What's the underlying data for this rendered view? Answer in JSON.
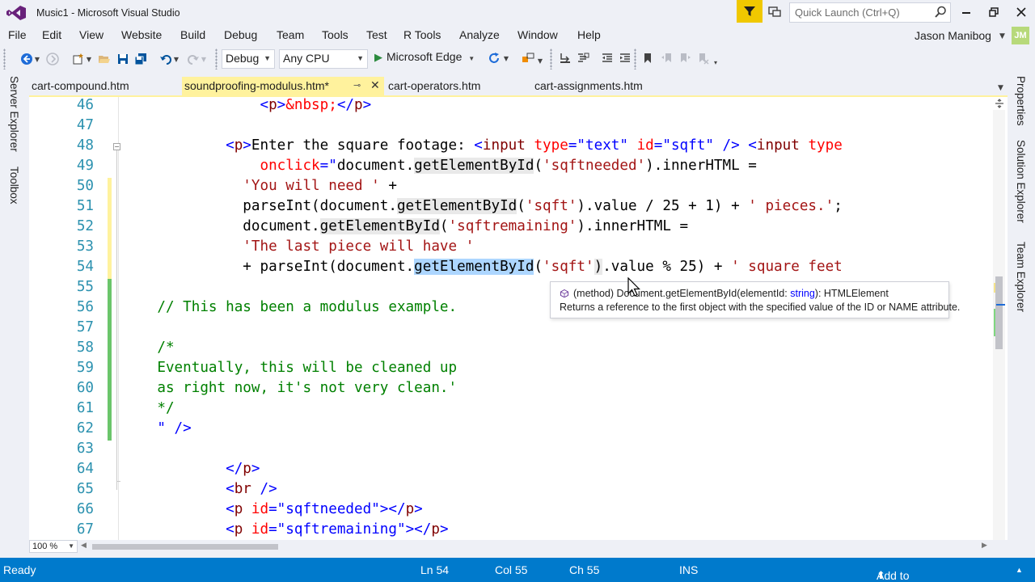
{
  "window": {
    "title": "Music1 - Microsoft Visual Studio",
    "quick_launch_placeholder": "Quick Launch (Ctrl+Q)",
    "user_name": "Jason Manibog",
    "user_initials": "JM"
  },
  "menu": [
    "File",
    "Edit",
    "View",
    "Website",
    "Build",
    "Debug",
    "Team",
    "Tools",
    "Test",
    "R Tools",
    "Analyze",
    "Window",
    "Help"
  ],
  "toolbar": {
    "configuration": "Debug",
    "platform": "Any CPU",
    "start_target": "Microsoft Edge"
  },
  "side_panels": {
    "left": [
      "Server Explorer",
      "Toolbox"
    ],
    "right": [
      "Properties",
      "Solution Explorer",
      "Team Explorer"
    ]
  },
  "tabs": [
    {
      "label": "cart-compound.htm",
      "active": false
    },
    {
      "label": "soundproofing-modulus.htm*",
      "active": true
    },
    {
      "label": "cart-operators.htm",
      "active": false
    },
    {
      "label": "cart-assignments.htm",
      "active": false
    }
  ],
  "editor": {
    "lines": [
      {
        "n": "46",
        "segments": [
          [
            "                <",
            "t-br"
          ],
          [
            "p",
            "t-tag"
          ],
          [
            ">",
            "t-br"
          ],
          [
            "&nbsp;",
            "t-attr"
          ],
          [
            "</",
            "t-br"
          ],
          [
            "p",
            "t-tag"
          ],
          [
            ">",
            "t-br"
          ]
        ]
      },
      {
        "n": "47",
        "segments": []
      },
      {
        "n": "48",
        "segments": [
          [
            "            <",
            "t-br"
          ],
          [
            "p",
            "t-tag"
          ],
          [
            ">",
            "t-br"
          ],
          [
            "Enter the square footage: ",
            ""
          ],
          [
            "<",
            "t-br"
          ],
          [
            "input",
            "t-tag"
          ],
          [
            " ",
            ""
          ],
          [
            "type",
            "t-attr"
          ],
          [
            "=",
            "t-br"
          ],
          [
            "\"text\"",
            "t-val"
          ],
          [
            " ",
            ""
          ],
          [
            "id",
            "t-attr"
          ],
          [
            "=",
            "t-br"
          ],
          [
            "\"sqft\"",
            "t-val"
          ],
          [
            " />",
            "t-br"
          ],
          [
            " <",
            "t-br"
          ],
          [
            "input",
            "t-tag"
          ],
          [
            " ",
            ""
          ],
          [
            "type",
            "t-attr"
          ]
        ]
      },
      {
        "n": "49",
        "segments": [
          [
            "                ",
            ""
          ],
          [
            "onclick",
            "t-attr"
          ],
          [
            "=",
            "t-br"
          ],
          [
            "\"",
            "t-val"
          ],
          [
            "document.",
            ""
          ],
          [
            "getElementById",
            "t-hl"
          ],
          [
            "(",
            ""
          ],
          [
            "'sqftneeded'",
            "t-str"
          ],
          [
            ").innerHTML =",
            ""
          ]
        ]
      },
      {
        "n": "50",
        "segments": [
          [
            "              ",
            ""
          ],
          [
            "'You will need '",
            "t-str"
          ],
          [
            " +",
            ""
          ]
        ]
      },
      {
        "n": "51",
        "segments": [
          [
            "              parseInt(document.",
            ""
          ],
          [
            "getElementById",
            "t-hl"
          ],
          [
            "(",
            ""
          ],
          [
            "'sqft'",
            "t-str"
          ],
          [
            ").value / 25 + 1) + ",
            ""
          ],
          [
            "' pieces.'",
            "t-str"
          ],
          [
            ";",
            ""
          ]
        ]
      },
      {
        "n": "52",
        "segments": [
          [
            "              document.",
            ""
          ],
          [
            "getElementById",
            "t-hl"
          ],
          [
            "(",
            ""
          ],
          [
            "'sqftremaining'",
            "t-str"
          ],
          [
            ").innerHTML =",
            ""
          ]
        ]
      },
      {
        "n": "53",
        "segments": [
          [
            "              ",
            ""
          ],
          [
            "'The last piece will have '",
            "t-str"
          ]
        ]
      },
      {
        "n": "54",
        "segments": [
          [
            "              + parseInt(document.",
            ""
          ],
          [
            "getElementById",
            "t-sel"
          ],
          [
            "(",
            ""
          ],
          [
            "'sqft'",
            "t-str"
          ],
          [
            ")",
            "t-hl"
          ],
          [
            ".value % 25) + ",
            ""
          ],
          [
            "' square feet",
            "t-str"
          ]
        ]
      },
      {
        "n": "55",
        "segments": []
      },
      {
        "n": "56",
        "segments": [
          [
            "    ",
            ""
          ],
          [
            "// This has been a modulus example.",
            "t-cmt"
          ]
        ]
      },
      {
        "n": "57",
        "segments": []
      },
      {
        "n": "58",
        "segments": [
          [
            "    ",
            ""
          ],
          [
            "/*",
            "t-cmt"
          ]
        ]
      },
      {
        "n": "59",
        "segments": [
          [
            "    ",
            ""
          ],
          [
            "Eventually, this will be cleaned up",
            "t-cmt"
          ]
        ]
      },
      {
        "n": "60",
        "segments": [
          [
            "    ",
            ""
          ],
          [
            "as right now, it's not very clean.'",
            "t-cmt"
          ]
        ]
      },
      {
        "n": "61",
        "segments": [
          [
            "    ",
            ""
          ],
          [
            "*/",
            "t-cmt"
          ]
        ]
      },
      {
        "n": "62",
        "segments": [
          [
            "    ",
            ""
          ],
          [
            "\" />",
            "t-val"
          ]
        ]
      },
      {
        "n": "63",
        "segments": []
      },
      {
        "n": "64",
        "segments": [
          [
            "            </",
            "t-br"
          ],
          [
            "p",
            "t-tag"
          ],
          [
            ">",
            "t-br"
          ]
        ]
      },
      {
        "n": "65",
        "segments": [
          [
            "            <",
            "t-br"
          ],
          [
            "br",
            "t-tag"
          ],
          [
            " />",
            "t-br"
          ]
        ]
      },
      {
        "n": "66",
        "segments": [
          [
            "            <",
            "t-br"
          ],
          [
            "p",
            "t-tag"
          ],
          [
            " ",
            ""
          ],
          [
            "id",
            "t-attr"
          ],
          [
            "=",
            "t-br"
          ],
          [
            "\"sqftneeded\"",
            "t-val"
          ],
          [
            "></",
            "t-br"
          ],
          [
            "p",
            "t-tag"
          ],
          [
            ">",
            "t-br"
          ]
        ]
      },
      {
        "n": "67",
        "segments": [
          [
            "            <",
            "t-br"
          ],
          [
            "p",
            "t-tag"
          ],
          [
            " ",
            ""
          ],
          [
            "id",
            "t-attr"
          ],
          [
            "=",
            "t-br"
          ],
          [
            "\"sqftremaining\"",
            "t-val"
          ],
          [
            "></",
            "t-br"
          ],
          [
            "p",
            "t-tag"
          ],
          [
            ">",
            "t-br"
          ]
        ]
      }
    ],
    "zoom": "100 %"
  },
  "tooltip": {
    "kind": "(method)",
    "signature_prefix": "Document.getElementById(elementId: ",
    "param_type": "string",
    "signature_suffix": "): HTMLElement",
    "description": "Returns a reference to the first object with the specified value of the ID or NAME attribute."
  },
  "status": {
    "state": "Ready",
    "line": "Ln 54",
    "col": "Col 55",
    "ch": "Ch 55",
    "mode": "INS",
    "source_control": "Add to Source Control"
  },
  "colors": {
    "status_bar": "#007acc",
    "active_tab": "#fff29d",
    "selection": "#add6ff",
    "filter_button": "#f0c800"
  }
}
